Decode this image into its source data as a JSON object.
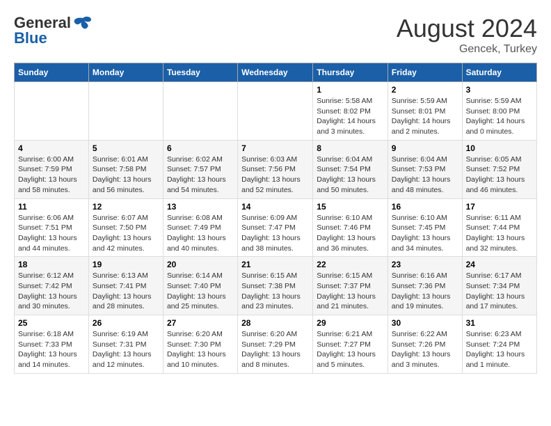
{
  "header": {
    "logo_general": "General",
    "logo_blue": "Blue",
    "month_year": "August 2024",
    "location": "Gencek, Turkey"
  },
  "days_of_week": [
    "Sunday",
    "Monday",
    "Tuesday",
    "Wednesday",
    "Thursday",
    "Friday",
    "Saturday"
  ],
  "weeks": [
    [
      {
        "day": "",
        "info": ""
      },
      {
        "day": "",
        "info": ""
      },
      {
        "day": "",
        "info": ""
      },
      {
        "day": "",
        "info": ""
      },
      {
        "day": "1",
        "info": "Sunrise: 5:58 AM\nSunset: 8:02 PM\nDaylight: 14 hours\nand 3 minutes."
      },
      {
        "day": "2",
        "info": "Sunrise: 5:59 AM\nSunset: 8:01 PM\nDaylight: 14 hours\nand 2 minutes."
      },
      {
        "day": "3",
        "info": "Sunrise: 5:59 AM\nSunset: 8:00 PM\nDaylight: 14 hours\nand 0 minutes."
      }
    ],
    [
      {
        "day": "4",
        "info": "Sunrise: 6:00 AM\nSunset: 7:59 PM\nDaylight: 13 hours\nand 58 minutes."
      },
      {
        "day": "5",
        "info": "Sunrise: 6:01 AM\nSunset: 7:58 PM\nDaylight: 13 hours\nand 56 minutes."
      },
      {
        "day": "6",
        "info": "Sunrise: 6:02 AM\nSunset: 7:57 PM\nDaylight: 13 hours\nand 54 minutes."
      },
      {
        "day": "7",
        "info": "Sunrise: 6:03 AM\nSunset: 7:56 PM\nDaylight: 13 hours\nand 52 minutes."
      },
      {
        "day": "8",
        "info": "Sunrise: 6:04 AM\nSunset: 7:54 PM\nDaylight: 13 hours\nand 50 minutes."
      },
      {
        "day": "9",
        "info": "Sunrise: 6:04 AM\nSunset: 7:53 PM\nDaylight: 13 hours\nand 48 minutes."
      },
      {
        "day": "10",
        "info": "Sunrise: 6:05 AM\nSunset: 7:52 PM\nDaylight: 13 hours\nand 46 minutes."
      }
    ],
    [
      {
        "day": "11",
        "info": "Sunrise: 6:06 AM\nSunset: 7:51 PM\nDaylight: 13 hours\nand 44 minutes."
      },
      {
        "day": "12",
        "info": "Sunrise: 6:07 AM\nSunset: 7:50 PM\nDaylight: 13 hours\nand 42 minutes."
      },
      {
        "day": "13",
        "info": "Sunrise: 6:08 AM\nSunset: 7:49 PM\nDaylight: 13 hours\nand 40 minutes."
      },
      {
        "day": "14",
        "info": "Sunrise: 6:09 AM\nSunset: 7:47 PM\nDaylight: 13 hours\nand 38 minutes."
      },
      {
        "day": "15",
        "info": "Sunrise: 6:10 AM\nSunset: 7:46 PM\nDaylight: 13 hours\nand 36 minutes."
      },
      {
        "day": "16",
        "info": "Sunrise: 6:10 AM\nSunset: 7:45 PM\nDaylight: 13 hours\nand 34 minutes."
      },
      {
        "day": "17",
        "info": "Sunrise: 6:11 AM\nSunset: 7:44 PM\nDaylight: 13 hours\nand 32 minutes."
      }
    ],
    [
      {
        "day": "18",
        "info": "Sunrise: 6:12 AM\nSunset: 7:42 PM\nDaylight: 13 hours\nand 30 minutes."
      },
      {
        "day": "19",
        "info": "Sunrise: 6:13 AM\nSunset: 7:41 PM\nDaylight: 13 hours\nand 28 minutes."
      },
      {
        "day": "20",
        "info": "Sunrise: 6:14 AM\nSunset: 7:40 PM\nDaylight: 13 hours\nand 25 minutes."
      },
      {
        "day": "21",
        "info": "Sunrise: 6:15 AM\nSunset: 7:38 PM\nDaylight: 13 hours\nand 23 minutes."
      },
      {
        "day": "22",
        "info": "Sunrise: 6:15 AM\nSunset: 7:37 PM\nDaylight: 13 hours\nand 21 minutes."
      },
      {
        "day": "23",
        "info": "Sunrise: 6:16 AM\nSunset: 7:36 PM\nDaylight: 13 hours\nand 19 minutes."
      },
      {
        "day": "24",
        "info": "Sunrise: 6:17 AM\nSunset: 7:34 PM\nDaylight: 13 hours\nand 17 minutes."
      }
    ],
    [
      {
        "day": "25",
        "info": "Sunrise: 6:18 AM\nSunset: 7:33 PM\nDaylight: 13 hours\nand 14 minutes."
      },
      {
        "day": "26",
        "info": "Sunrise: 6:19 AM\nSunset: 7:31 PM\nDaylight: 13 hours\nand 12 minutes."
      },
      {
        "day": "27",
        "info": "Sunrise: 6:20 AM\nSunset: 7:30 PM\nDaylight: 13 hours\nand 10 minutes."
      },
      {
        "day": "28",
        "info": "Sunrise: 6:20 AM\nSunset: 7:29 PM\nDaylight: 13 hours\nand 8 minutes."
      },
      {
        "day": "29",
        "info": "Sunrise: 6:21 AM\nSunset: 7:27 PM\nDaylight: 13 hours\nand 5 minutes."
      },
      {
        "day": "30",
        "info": "Sunrise: 6:22 AM\nSunset: 7:26 PM\nDaylight: 13 hours\nand 3 minutes."
      },
      {
        "day": "31",
        "info": "Sunrise: 6:23 AM\nSunset: 7:24 PM\nDaylight: 13 hours\nand 1 minute."
      }
    ]
  ]
}
